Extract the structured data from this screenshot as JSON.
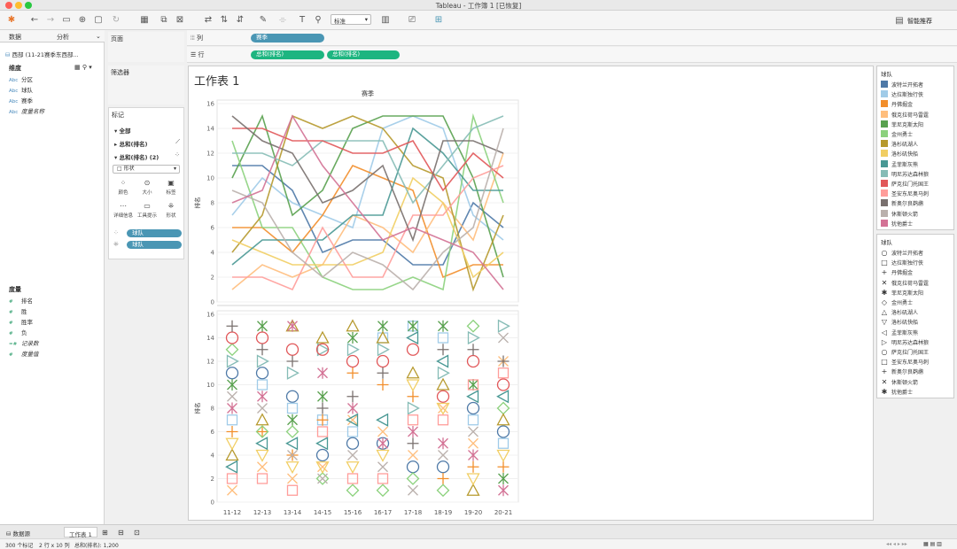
{
  "window": {
    "title": "Tableau - 工作簿 1 [已恢复]",
    "close_color": "#fe5f57",
    "min_color": "#febc2e",
    "max_color": "#28c840"
  },
  "toolbar": {
    "standard_select": "标准",
    "smart_recommend": "智能推荐"
  },
  "left_pane": {
    "tab_data": "数据",
    "tab_analysis": "分析",
    "datasource": "西部 (11-21赛季东西部...",
    "dimensions_title": "维度",
    "dimensions": [
      {
        "icon": "Abc",
        "label": "分区",
        "italic": false
      },
      {
        "icon": "Abc",
        "label": "球队",
        "italic": false
      },
      {
        "icon": "Abc",
        "label": "赛季",
        "italic": false
      },
      {
        "icon": "Abc",
        "label": "度量名称",
        "italic": true
      }
    ],
    "measures_title": "度量",
    "measures": [
      {
        "icon": "#",
        "label": "排名",
        "italic": false
      },
      {
        "icon": "#",
        "label": "胜",
        "italic": false
      },
      {
        "icon": "#",
        "label": "胜率",
        "italic": false
      },
      {
        "icon": "#",
        "label": "负",
        "italic": false
      },
      {
        "icon": "=#",
        "label": "记录数",
        "italic": true
      },
      {
        "icon": "#",
        "label": "度量值",
        "italic": true
      }
    ]
  },
  "mid_pane": {
    "pages": "页面",
    "filters": "筛选器",
    "marks": "标记",
    "mark_all": "全部",
    "mark_sum1": "总和(排名)",
    "mark_sum2": "总和(排名) (2)",
    "shape_type": "形状",
    "buttons": [
      "颜色",
      "大小",
      "标签",
      "详细信息",
      "工具提示",
      "形状"
    ],
    "pill_color": "球队",
    "pill_shape": "球队"
  },
  "shelves": {
    "columns_label": "列",
    "rows_label": "行",
    "columns_pill": "赛季",
    "rows_pill1": "总和(排名)",
    "rows_pill2": "总和(排名)",
    "dim_color": "#4a96b4",
    "measure_color": "#1db580"
  },
  "sheet": {
    "title": "工作表 1",
    "column_header": "赛季",
    "y_label": "排名"
  },
  "legend_color_title": "球队",
  "legend_shape_title": "球队",
  "teams": [
    {
      "name": "波特兰开拓者",
      "color": "#4e79a7",
      "shape": "circle"
    },
    {
      "name": "达拉斯独行侠",
      "color": "#a0cbe8",
      "shape": "square"
    },
    {
      "name": "丹佛掘金",
      "color": "#f28e2b",
      "shape": "plus"
    },
    {
      "name": "俄克拉荷马雷霆",
      "color": "#ffbe7d",
      "shape": "x"
    },
    {
      "name": "菲尼克斯太阳",
      "color": "#59a14f",
      "shape": "asterisk"
    },
    {
      "name": "金州勇士",
      "color": "#8cd17d",
      "shape": "diamond"
    },
    {
      "name": "洛杉矶湖人",
      "color": "#b6992d",
      "shape": "triangle-up"
    },
    {
      "name": "洛杉矶快船",
      "color": "#f1ce63",
      "shape": "triangle-down"
    },
    {
      "name": "孟菲斯灰熊",
      "color": "#499894",
      "shape": "triangle-left"
    },
    {
      "name": "明尼苏达森林狼",
      "color": "#86bcb6",
      "shape": "triangle-right"
    },
    {
      "name": "萨克拉门托国王",
      "color": "#e15759",
      "shape": "circle"
    },
    {
      "name": "圣安东尼奥马刺",
      "color": "#ff9d9a",
      "shape": "square"
    },
    {
      "name": "新奥尔良鹈鹕",
      "color": "#79706e",
      "shape": "plus"
    },
    {
      "name": "休斯顿火箭",
      "color": "#bab0ac",
      "shape": "x"
    },
    {
      "name": "犹他爵士",
      "color": "#d37295",
      "shape": "asterisk"
    }
  ],
  "shape_glyphs": {
    "circle": "○",
    "square": "□",
    "plus": "+",
    "x": "✕",
    "asterisk": "✱",
    "diamond": "◇",
    "triangle-up": "△",
    "triangle-down": "▽",
    "triangle-left": "◁",
    "triangle-right": "▷"
  },
  "chart_data": [
    {
      "type": "line",
      "title": "",
      "column_header": "赛季",
      "ylabel": "排名",
      "ylim": [
        0,
        16
      ],
      "yticks": [
        0,
        2,
        4,
        6,
        8,
        10,
        12,
        14,
        16
      ],
      "categories": [
        "11-12",
        "12-13",
        "13-14",
        "14-15",
        "15-16",
        "16-17",
        "17-18",
        "18-19",
        "19-20",
        "20-21"
      ],
      "series": [
        {
          "name": "波特兰开拓者",
          "values": [
            11,
            11,
            9,
            4,
            5,
            5,
            3,
            3,
            8,
            6
          ]
        },
        {
          "name": "达拉斯独行侠",
          "values": [
            7,
            10,
            8,
            7,
            6,
            14,
            15,
            14,
            7,
            5
          ]
        },
        {
          "name": "丹佛掘金",
          "values": [
            6,
            6,
            4,
            7,
            11,
            10,
            9,
            2,
            3,
            3
          ]
        },
        {
          "name": "俄克拉荷马雷霆",
          "values": [
            1,
            3,
            2,
            3,
            7,
            6,
            4,
            8,
            5,
            12
          ]
        },
        {
          "name": "菲尼克斯太阳",
          "values": [
            10,
            15,
            7,
            9,
            14,
            15,
            15,
            15,
            10,
            2
          ]
        },
        {
          "name": "金州勇士",
          "values": [
            13,
            6,
            6,
            2,
            1,
            1,
            2,
            1,
            15,
            8
          ]
        },
        {
          "name": "洛杉矶湖人",
          "values": [
            4,
            7,
            15,
            14,
            15,
            14,
            11,
            10,
            1,
            7
          ]
        },
        {
          "name": "洛杉矶快船",
          "values": [
            5,
            4,
            3,
            3,
            3,
            4,
            10,
            8,
            2,
            4
          ]
        },
        {
          "name": "孟菲斯灰熊",
          "values": [
            3,
            5,
            5,
            5,
            7,
            7,
            14,
            12,
            9,
            9
          ]
        },
        {
          "name": "明尼苏达森林狼",
          "values": [
            12,
            12,
            11,
            13,
            13,
            13,
            8,
            11,
            14,
            15
          ]
        },
        {
          "name": "萨克拉门托国王",
          "values": [
            14,
            14,
            13,
            13,
            12,
            12,
            13,
            9,
            12,
            10
          ]
        },
        {
          "name": "圣安东尼奥马刺",
          "values": [
            2,
            2,
            1,
            6,
            2,
            2,
            7,
            7,
            10,
            11
          ]
        },
        {
          "name": "新奥尔良鹈鹕",
          "values": [
            15,
            13,
            12,
            8,
            9,
            11,
            5,
            13,
            13,
            12
          ]
        },
        {
          "name": "休斯顿火箭",
          "values": [
            9,
            8,
            4,
            2,
            4,
            3,
            1,
            4,
            6,
            14
          ]
        },
        {
          "name": "犹他爵士",
          "values": [
            8,
            9,
            15,
            11,
            8,
            5,
            6,
            5,
            4,
            1
          ]
        }
      ]
    },
    {
      "type": "scatter",
      "title": "",
      "ylabel": "排名",
      "ylim": [
        0,
        16
      ],
      "yticks": [
        0,
        2,
        4,
        6,
        8,
        10,
        12,
        14,
        16
      ],
      "categories": [
        "11-12",
        "12-13",
        "13-14",
        "14-15",
        "15-16",
        "16-17",
        "17-18",
        "18-19",
        "19-20",
        "20-21"
      ],
      "marks": "same values as line chart; one shape per team per season"
    }
  ],
  "bottom": {
    "datasource_tab": "数据源",
    "sheet_tab": "工作表 1"
  },
  "status": {
    "marks": "300 个标记",
    "rowscols": "2 行 x 10 列",
    "sum": "总和(排名): 1,200"
  }
}
